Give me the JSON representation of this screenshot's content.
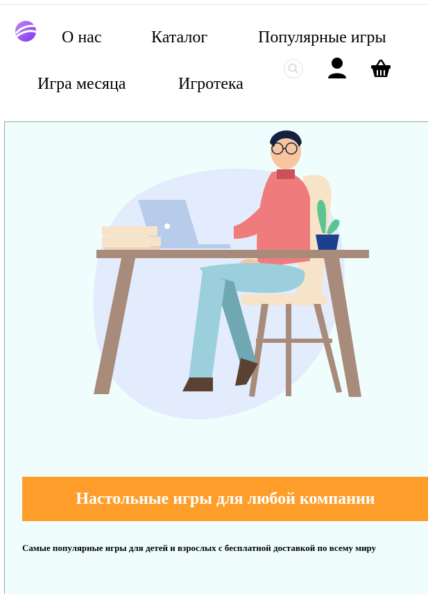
{
  "header": {
    "logo_icon": "planet-logo-icon",
    "nav": [
      {
        "label": "О нас"
      },
      {
        "label": "Каталог"
      },
      {
        "label": "Популярные игры"
      },
      {
        "label": "Игра месяца"
      },
      {
        "label": "Игротека"
      }
    ],
    "icons": [
      "search-icon",
      "user-icon",
      "basket-icon"
    ]
  },
  "hero": {
    "illustration_icon": "man-at-laptop-illustration",
    "banner_title": "Настольные игры для любой компании",
    "subtitle": "Самые популярные игры для детей и взрослых с бесплатной доставкой по всему миру"
  },
  "colors": {
    "banner": "#ff9d2a",
    "hero_bg": "#effefd",
    "logo": "#8b5cf6"
  }
}
